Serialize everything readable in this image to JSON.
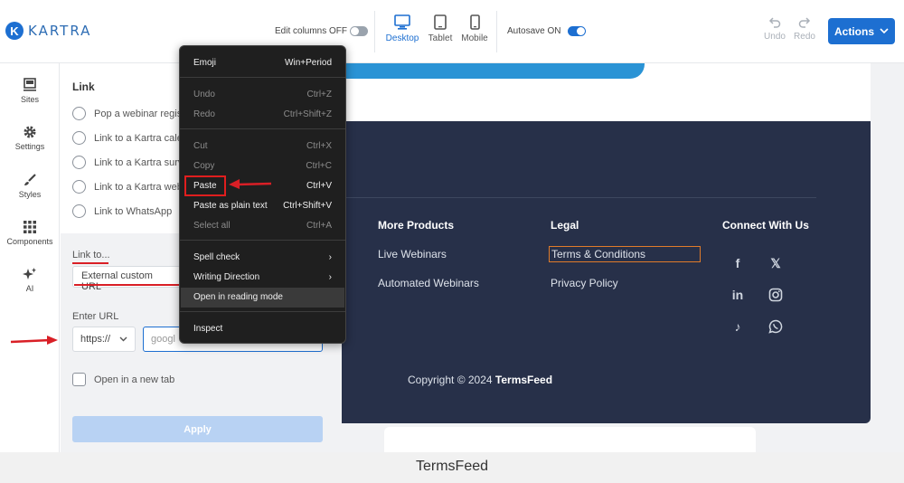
{
  "app": {
    "logo_letter": "K",
    "logo_text": "KARTRA"
  },
  "toolbar": {
    "edit_columns_label": "Edit columns OFF",
    "devices": [
      {
        "label": "Desktop"
      },
      {
        "label": "Tablet"
      },
      {
        "label": "Mobile"
      }
    ],
    "autosave_label": "Autosave ON",
    "undo_label": "Undo",
    "redo_label": "Redo",
    "actions_label": "Actions"
  },
  "sidebar": {
    "items": [
      {
        "label": "Sites"
      },
      {
        "label": "Settings"
      },
      {
        "label": "Styles"
      },
      {
        "label": "Components"
      },
      {
        "label": "AI"
      }
    ]
  },
  "link_panel": {
    "title": "Link",
    "options": [
      {
        "label": "Pop a webinar regis"
      },
      {
        "label": "Link to a Kartra cale"
      },
      {
        "label": "Link to a Kartra surv"
      },
      {
        "label": "Link to a Kartra web"
      },
      {
        "label": "Link to WhatsApp"
      }
    ],
    "link_to_label": "Link to...",
    "link_to_value": "External custom URL",
    "enter_url_label": "Enter URL",
    "protocol_value": "https://",
    "url_value": "googl",
    "new_tab_label": "Open in a new tab",
    "apply_label": "Apply"
  },
  "context_menu": {
    "items": [
      {
        "label": "Emoji",
        "shortcut": "Win+Period"
      },
      {
        "label": "Undo",
        "shortcut": "Ctrl+Z"
      },
      {
        "label": "Redo",
        "shortcut": "Ctrl+Shift+Z"
      },
      {
        "label": "Cut",
        "shortcut": "Ctrl+X"
      },
      {
        "label": "Copy",
        "shortcut": "Ctrl+C"
      },
      {
        "label": "Paste",
        "shortcut": "Ctrl+V"
      },
      {
        "label": "Paste as plain text",
        "shortcut": "Ctrl+Shift+V"
      },
      {
        "label": "Select all",
        "shortcut": "Ctrl+A"
      },
      {
        "label": "Spell check",
        "shortcut": "›"
      },
      {
        "label": "Writing Direction",
        "shortcut": "›"
      },
      {
        "label": "Open in reading mode",
        "shortcut": ""
      },
      {
        "label": "Inspect",
        "shortcut": ""
      }
    ]
  },
  "footer": {
    "col1": {
      "heading": "More Products",
      "links": [
        "Live Webinars",
        "Automated Webinars"
      ]
    },
    "col2": {
      "heading": "Legal",
      "links": [
        "Terms & Conditions",
        "Privacy Policy"
      ]
    },
    "col3": {
      "heading": "Connect With Us"
    },
    "copyright_prefix": "Copyright © 2024 ",
    "copyright_brand": "TermsFeed"
  },
  "caption": "TermsFeed",
  "colors": {
    "accent": "#1d6fd1",
    "footer_bg": "#273049",
    "annotation_red": "#d91f26",
    "highlight_orange": "#e07b2a"
  }
}
